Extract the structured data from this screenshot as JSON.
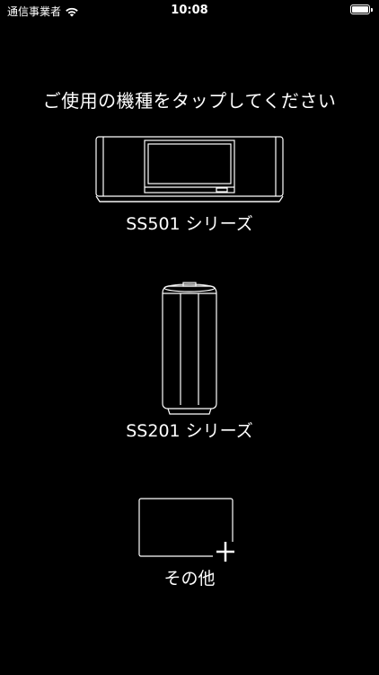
{
  "status": {
    "carrier": "通信事業者",
    "time": "10:08"
  },
  "heading": "ご使用の機種をタップしてください",
  "devices": [
    {
      "label": "SS501 シリーズ"
    },
    {
      "label": "SS201 シリーズ"
    },
    {
      "label": "その他"
    }
  ]
}
